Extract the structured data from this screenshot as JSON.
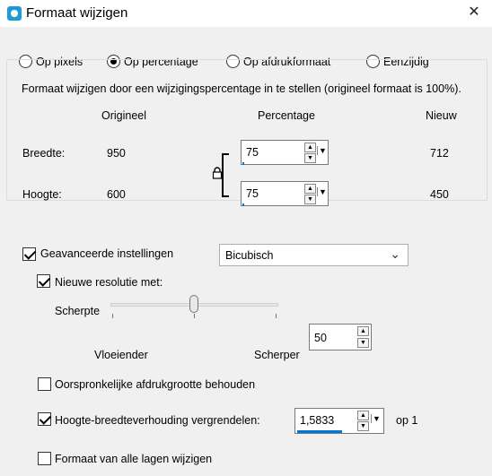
{
  "window": {
    "title": "Formaat wijzigen",
    "close_glyph": "✕",
    "icon": "app-icon"
  },
  "mode": {
    "options": [
      {
        "label": "Op pixels",
        "checked": false
      },
      {
        "label": "Op percentage",
        "checked": true
      },
      {
        "label": "Op afdrukformaat",
        "checked": false
      },
      {
        "label": "Eenzijdig",
        "checked": false
      }
    ]
  },
  "group": {
    "caption": "Formaat wijzigen door een wijzigingspercentage in te stellen (origineel formaat  is 100%).",
    "headers": {
      "original": "Origineel",
      "percentage": "Percentage",
      "new": "Nieuw"
    },
    "width": {
      "label": "Breedte:",
      "original": "950",
      "percentage": "75",
      "new": "712"
    },
    "height": {
      "label": "Hoogte:",
      "original": "600",
      "percentage": "75",
      "new": "450"
    },
    "lock_icon": "lock-icon"
  },
  "advanced": {
    "label": "Geavanceerde instellingen",
    "checked": true
  },
  "resolution": {
    "label": "Nieuwe resolutie met:",
    "checked": true,
    "method": "Bicubisch"
  },
  "sharpness": {
    "label": "Scherpte",
    "left_label": "Vloeiender",
    "right_label": "Scherper",
    "value": "50",
    "level": 50
  },
  "keep_print_size": {
    "label": "Oorspronkelijke afdrukgrootte behouden",
    "checked": false
  },
  "aspect_lock": {
    "label": "Hoogte-breedteverhouding vergrendelen:",
    "checked": true,
    "value": "1,5833",
    "suffix": "op 1"
  },
  "all_layers": {
    "label": "Formaat van alle lagen wijzigen",
    "checked": false
  },
  "colors": {
    "accent": "#0078d7",
    "background": "#f0f0f0"
  }
}
